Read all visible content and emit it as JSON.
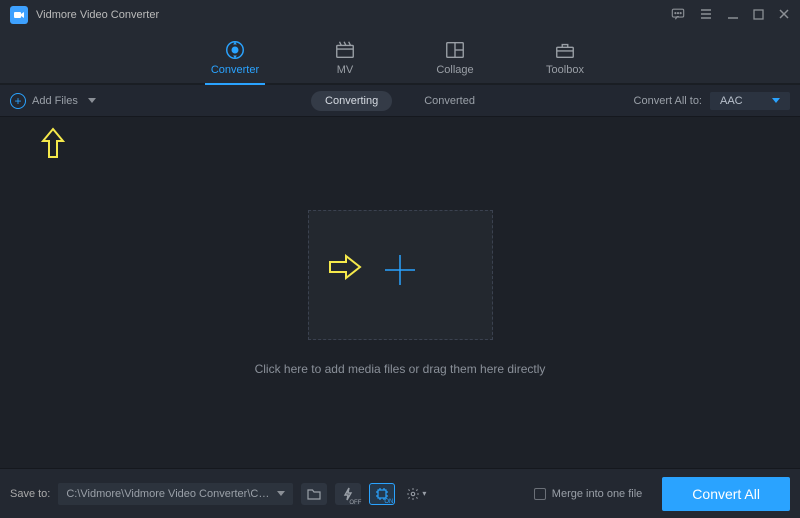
{
  "app": {
    "title": "Vidmore Video Converter"
  },
  "tabs": [
    {
      "label": "Converter",
      "active": true
    },
    {
      "label": "MV",
      "active": false
    },
    {
      "label": "Collage",
      "active": false
    },
    {
      "label": "Toolbox",
      "active": false
    }
  ],
  "secbar": {
    "add_files": "Add Files",
    "seg_converting": "Converting",
    "seg_converted": "Converted",
    "convert_all_to_label": "Convert All to:",
    "format_selected": "AAC"
  },
  "main": {
    "hint": "Click here to add media files or drag them here directly"
  },
  "bottom": {
    "save_to_label": "Save to:",
    "save_path": "C:\\Vidmore\\Vidmore Video Converter\\Converted",
    "merge_label": "Merge into one file",
    "convert_all_label": "Convert All"
  }
}
